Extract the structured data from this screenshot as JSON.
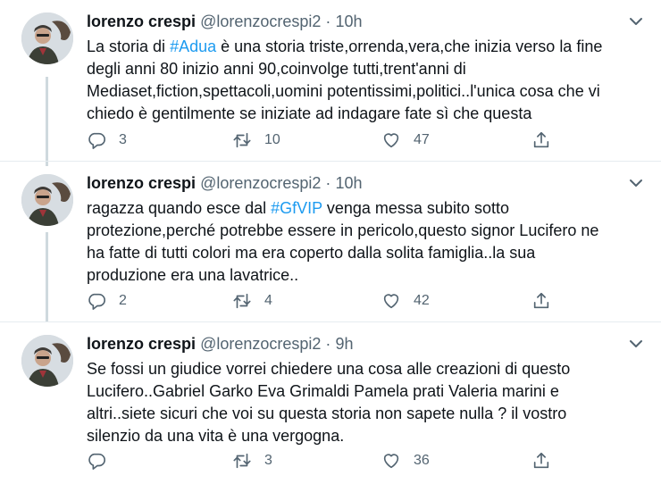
{
  "colors": {
    "accent": "#1d9bf0",
    "secondary_text": "#536471",
    "divider": "#e6ecf0"
  },
  "tweets": [
    {
      "name": "lorenzo crespi",
      "handle": "@lorenzocrespi2",
      "dot": "·",
      "time": "10h",
      "text_parts": [
        "La storia di ",
        "#Adua",
        " è una storia triste,orrenda,vera,che inizia verso la fine\ndegli anni 80 inizio anni 90,coinvolge tutti,trent'anni di\nMediaset,fiction,spettacoli,uomini potentissimi,politici..l'unica cosa che vi\nchiedo è gentilmente se iniziate ad indagare fate sì che questa"
      ],
      "replies": "3",
      "retweets": "10",
      "likes": "47"
    },
    {
      "name": "lorenzo crespi",
      "handle": "@lorenzocrespi2",
      "dot": "·",
      "time": "10h",
      "text_parts": [
        "ragazza quando esce dal ",
        "#GfVIP",
        " venga messa subito sotto\nprotezione,perché potrebbe essere in pericolo,questo signor Lucifero ne\nha fatte di tutti colori ma era coperto dalla solita famiglia..la sua\nproduzione era una lavatrice.."
      ],
      "replies": "2",
      "retweets": "4",
      "likes": "42"
    },
    {
      "name": "lorenzo crespi",
      "handle": "@lorenzocrespi2",
      "dot": "·",
      "time": "9h",
      "text_parts": [
        "Se fossi un giudice vorrei chiedere una cosa alle creazioni di questo\nLucifero..Gabriel Garko Eva Grimaldi Pamela prati Valeria marini e\naltri..siete sicuri che voi su questa storia non sapete nulla ? il vostro\nsilenzio da una vita è una vergogna."
      ],
      "replies": "",
      "retweets": "3",
      "likes": "36"
    }
  ],
  "icons": {
    "avatar": "profile-photo",
    "caret": "chevron-down-icon",
    "reply": "reply-icon",
    "retweet": "retweet-icon",
    "like": "heart-icon",
    "share": "share-icon"
  }
}
